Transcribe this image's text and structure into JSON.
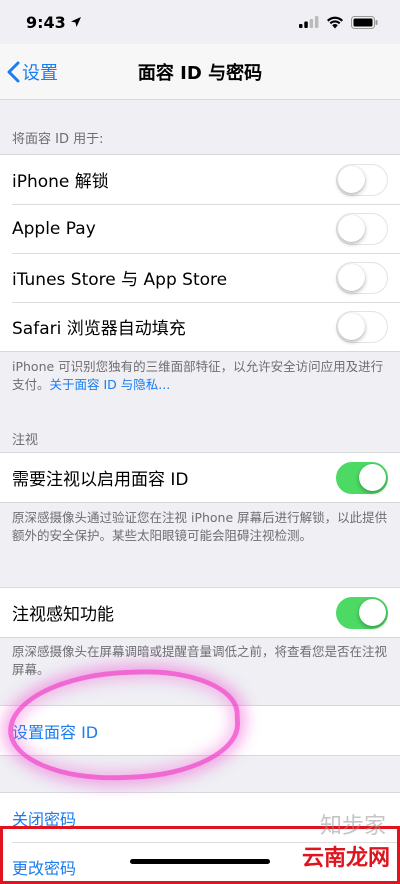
{
  "status": {
    "time": "9:43",
    "location_icon": "location-arrow-icon",
    "signal_icon": "cellular-signal-icon",
    "wifi_icon": "wifi-icon",
    "battery_icon": "battery-icon"
  },
  "nav": {
    "back_label": "设置",
    "title": "面容 ID 与密码"
  },
  "use_for": {
    "header": "将面容 ID 用于:",
    "items": [
      {
        "label": "iPhone 解锁",
        "on": false
      },
      {
        "label": "Apple Pay",
        "on": false
      },
      {
        "label": "iTunes Store 与 App Store",
        "on": false
      },
      {
        "label": "Safari 浏览器自动填充",
        "on": false
      }
    ],
    "footer_text": "iPhone 可识别您独有的三维面部特征，以允许安全访问应用及进行支付。",
    "footer_link": "关于面容 ID 与隐私..."
  },
  "attention": {
    "header": "注视",
    "require_label": "需要注视以启用面容 ID",
    "require_on": true,
    "require_footer": "原深感摄像头通过验证您在注视 iPhone 屏幕后进行解锁，以此提供额外的安全保护。某些太阳眼镜可能会阻碍注视检测。",
    "aware_label": "注视感知功能",
    "aware_on": true,
    "aware_footer": "原深感摄像头在屏幕调暗或提醒音量调低之前，将查看您是否在注视屏幕。"
  },
  "setup": {
    "label": "设置面容 ID"
  },
  "passcode": {
    "turn_off_label": "关闭密码",
    "change_label": "更改密码"
  },
  "watermark": {
    "brand": "云南龙网",
    "faint": "知步家"
  },
  "colors": {
    "accent": "#1a7df0",
    "toggle_on": "#4cd964",
    "highlight": "#f050d0",
    "red_box": "#e0141e"
  }
}
